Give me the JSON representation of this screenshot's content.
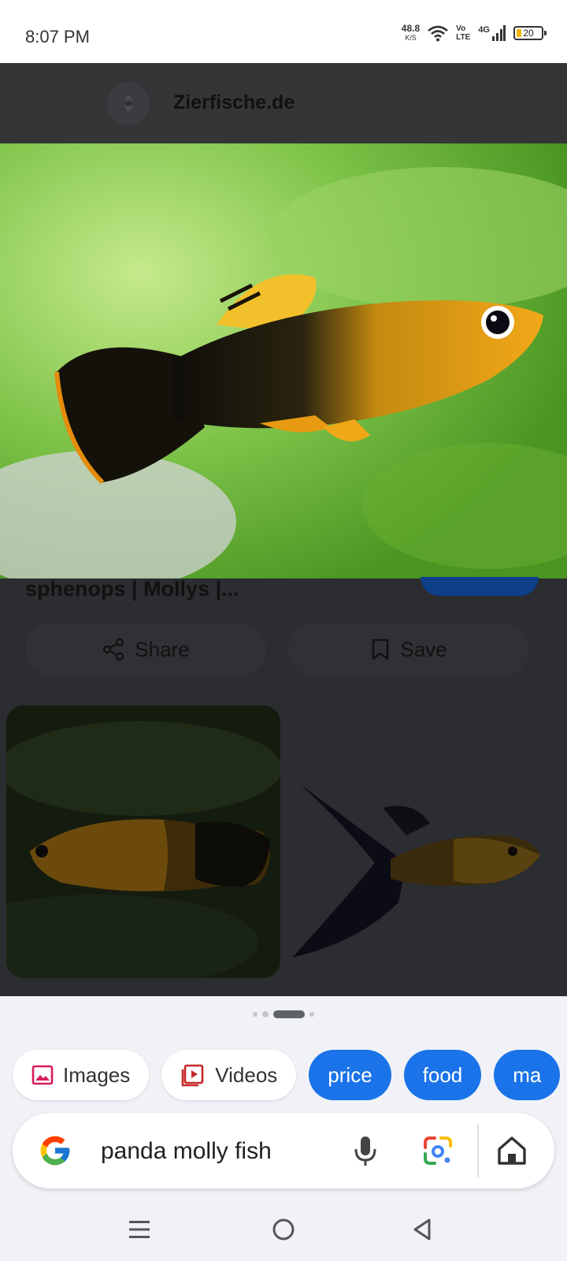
{
  "status": {
    "time": "8:07 PM",
    "net_speed_value": "48.8",
    "net_speed_unit": "K/S",
    "volte_top": "Vo",
    "volte_bottom": "LTE",
    "network": "4G",
    "battery": "20"
  },
  "source": {
    "name": "Zierfische.de"
  },
  "result": {
    "title": "sphenops | Mollys |..."
  },
  "actions": {
    "share_label": "Share",
    "save_label": "Save"
  },
  "pager": {
    "count": 4,
    "active_index": 2
  },
  "chips": [
    {
      "label": "Images",
      "icon": "image-icon",
      "style": "white"
    },
    {
      "label": "Videos",
      "icon": "video-icon",
      "style": "white"
    },
    {
      "label": "price",
      "style": "blue"
    },
    {
      "label": "food",
      "style": "blue"
    },
    {
      "label": "ma",
      "style": "blue"
    }
  ],
  "search": {
    "query": "panda molly fish"
  },
  "colors": {
    "accent": "#1a73e8",
    "battery": "#f4b400",
    "dim_overlay": "#2b2d30"
  }
}
